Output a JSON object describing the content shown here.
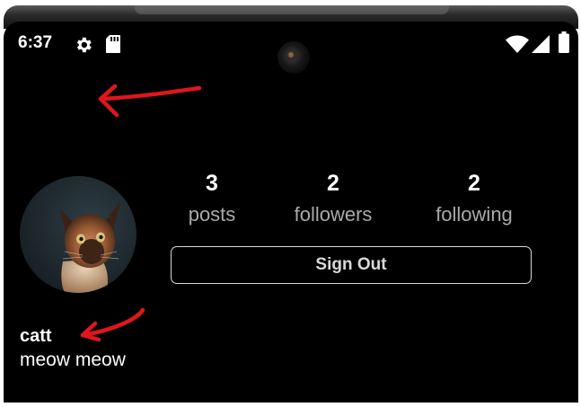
{
  "status_bar": {
    "time": "6:37",
    "icons": [
      "gear-icon",
      "sd-card-icon",
      "wifi-icon",
      "cellular-signal-icon",
      "battery-icon"
    ]
  },
  "profile": {
    "username": "catt",
    "bio": "meow meow",
    "avatar": "cat-photo-avatar",
    "stats": [
      {
        "count": "3",
        "label": "posts"
      },
      {
        "count": "2",
        "label": "followers"
      },
      {
        "count": "2",
        "label": "following"
      }
    ],
    "sign_out_label": "Sign Out"
  },
  "colors": {
    "background": "#000000",
    "primary_text": "#ffffff",
    "secondary_text": "#a9a9a9",
    "button_border": "#d9d9d9",
    "annotation_arrow": "#e0161b"
  }
}
